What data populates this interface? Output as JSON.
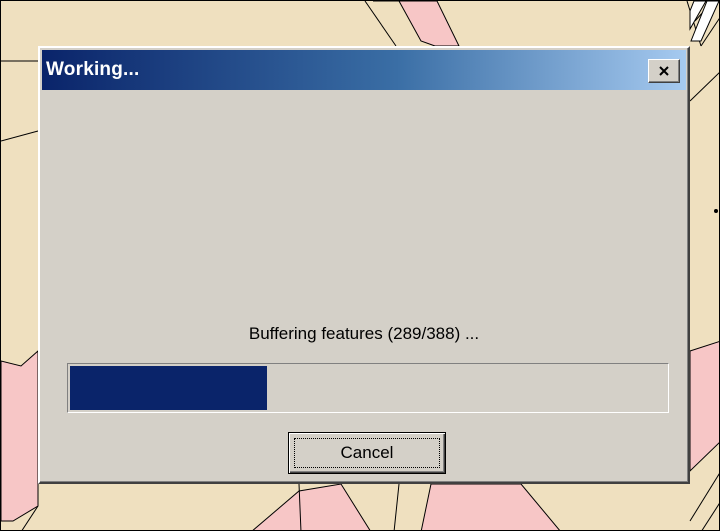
{
  "dialog": {
    "title": "Working...",
    "close_icon": "close-icon",
    "status_text": "Buffering features (289/388) ...",
    "progress": {
      "current": 289,
      "total": 388,
      "displayed_fill_fraction": 0.33
    },
    "cancel_label": "Cancel"
  },
  "colors": {
    "map_background": "#efe0bf",
    "parcel_fill": "#f7c6c6",
    "title_gradient_start": "#0a246a",
    "title_gradient_end": "#a6caf0",
    "progress_fill": "#0a246a",
    "dialog_face": "#d4d0c8"
  }
}
